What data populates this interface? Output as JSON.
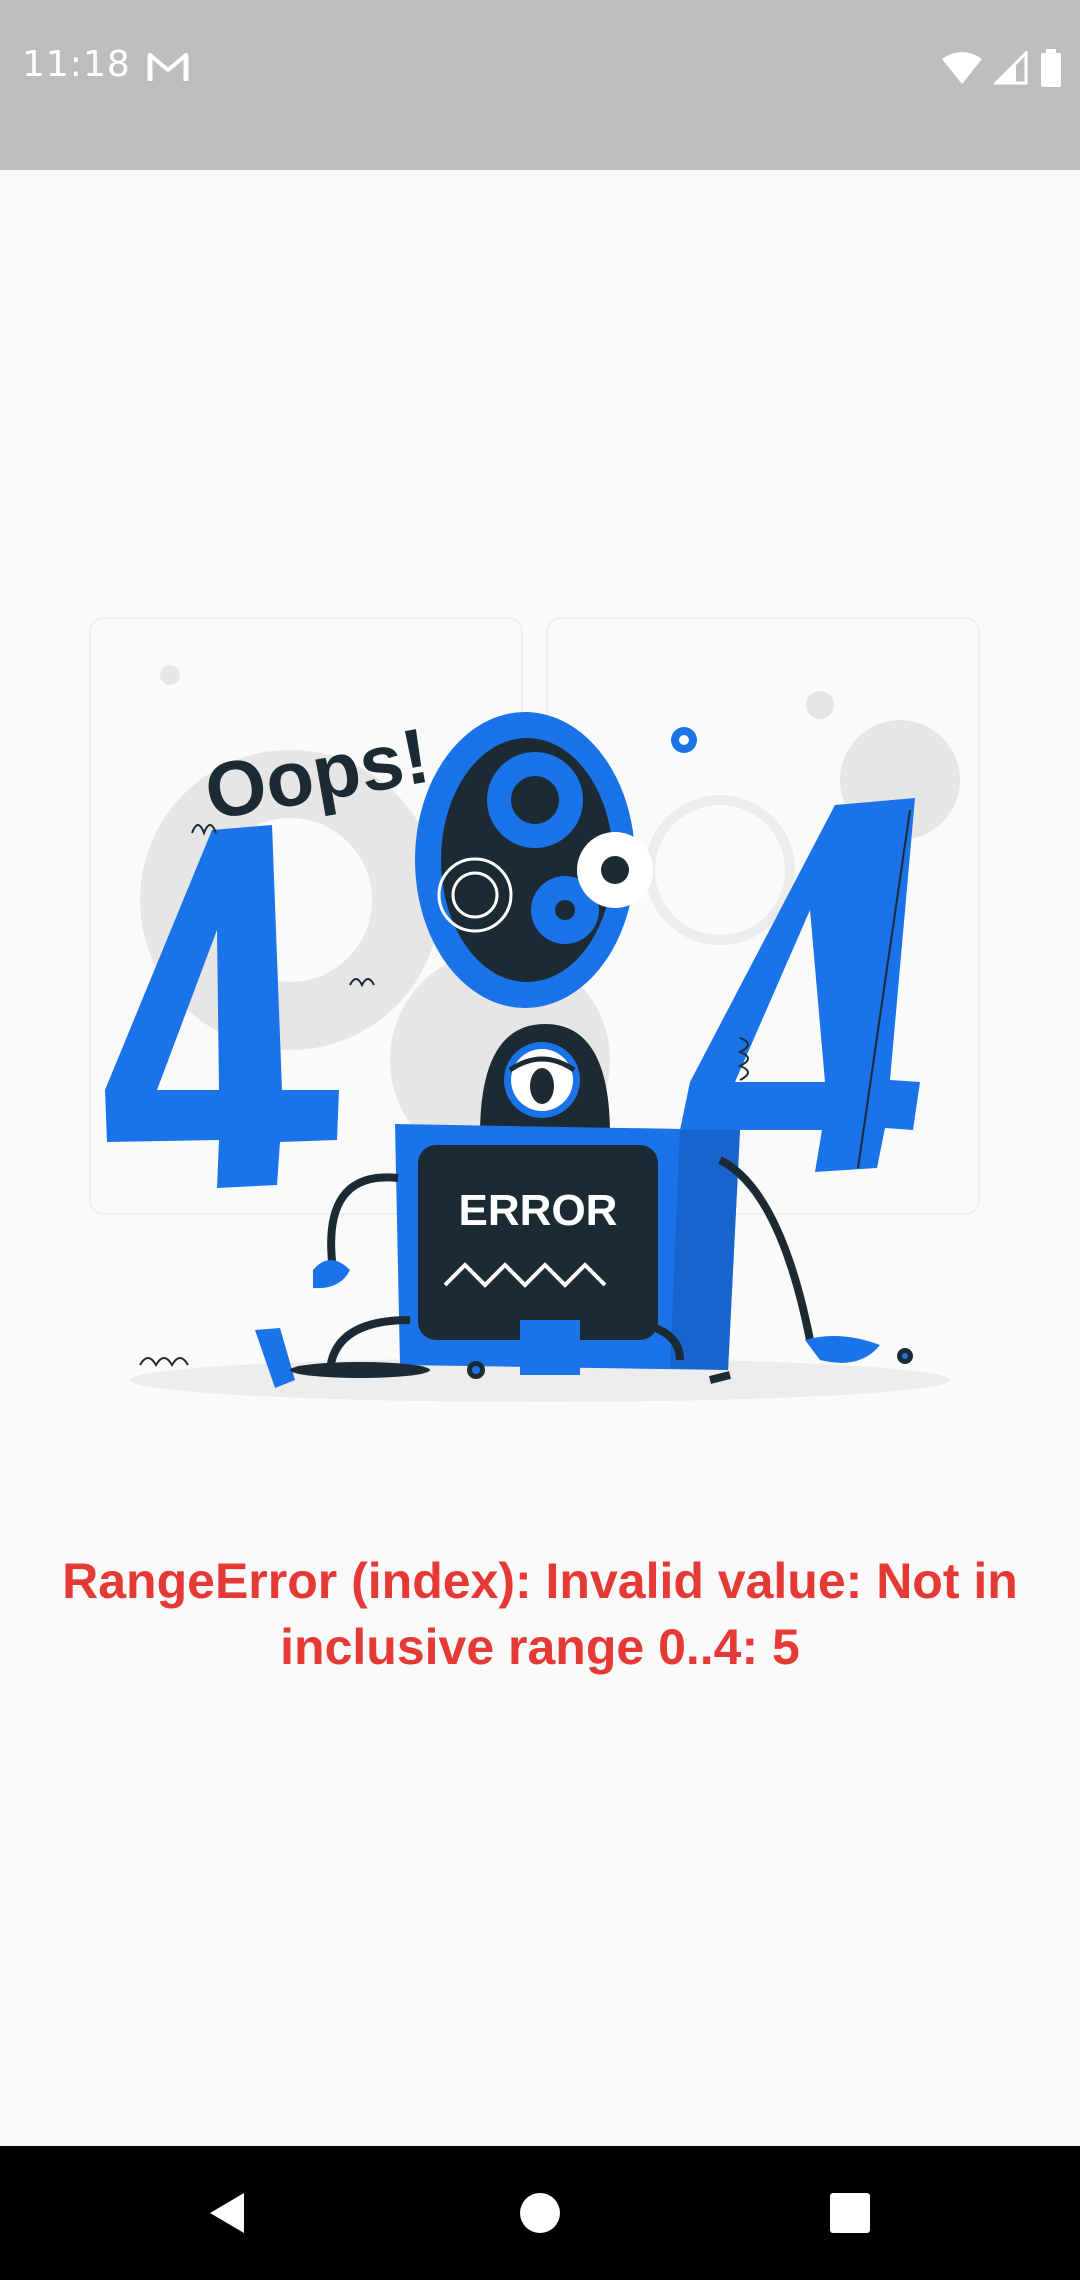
{
  "status_bar": {
    "time": "11:18",
    "notification_icon": "gmail-icon",
    "icons": [
      "wifi-icon",
      "cellular-signal-icon",
      "battery-icon"
    ]
  },
  "illustration": {
    "caption_text": "Oops!",
    "digits": [
      "4",
      "0",
      "4"
    ],
    "screen_label": "ERROR",
    "accent_color": "#1a73e8",
    "dark_color": "#1c2b33"
  },
  "error": {
    "message": "RangeError (index): Invalid value: Not in inclusive range 0..4: 5",
    "color": "#e53935"
  },
  "nav_bar": {
    "buttons": [
      "back-icon",
      "home-icon",
      "recents-icon"
    ]
  }
}
